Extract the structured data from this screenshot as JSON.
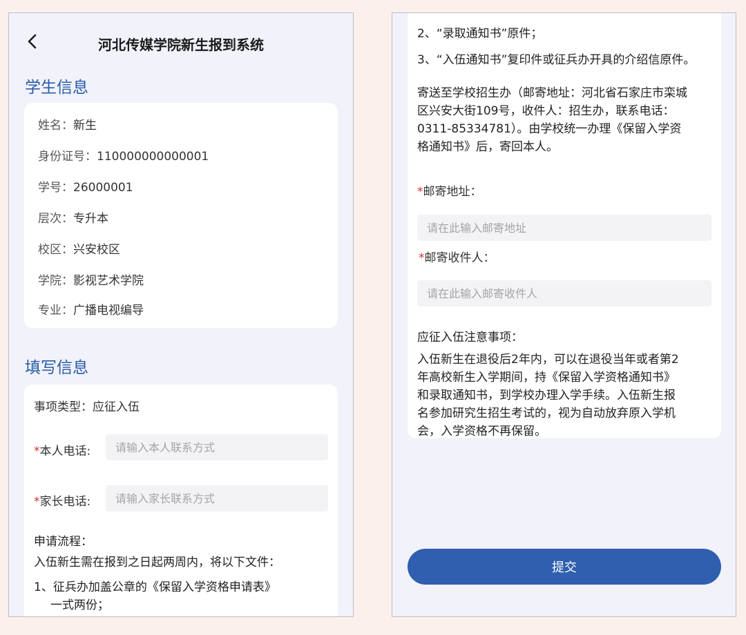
{
  "header": {
    "title": "河北传媒学院新生报到系统"
  },
  "student_info": {
    "section_title": "学生信息",
    "rows": [
      {
        "label": "姓名：",
        "value": "新生"
      },
      {
        "label": "身份证号：",
        "value": "110000000000001"
      },
      {
        "label": "学号：",
        "value": "26000001"
      },
      {
        "label": "层次：",
        "value": "专升本"
      },
      {
        "label": "校区：",
        "value": "兴安校区"
      },
      {
        "label": "学院：",
        "value": "影视艺术学院"
      },
      {
        "label": "专业：",
        "value": "广播电视编导"
      }
    ]
  },
  "fill_info": {
    "section_title": "填写信息",
    "item_type_label": "事项类型：",
    "item_type_value": "应征入伍",
    "phone": {
      "required": "*",
      "label": "本人电话:",
      "placeholder": "请输入本人联系方式",
      "value": ""
    },
    "parent_phone": {
      "required": "*",
      "label": "家长电话:",
      "placeholder": "请输入家长联系方式",
      "value": ""
    },
    "process_title": "申请流程：",
    "process_intro": "入伍新生需在报到之日起两周内，将以下文件：",
    "process_item_1_line1": "1、征兵办加盖公章的《保留入学资格申请表》",
    "process_item_1_line2": "一式两份；",
    "process_item_2": "2、“录取通知书”原件；",
    "process_item_3": "3、“入伍通知书”复印件或征兵办开具的介绍信原件。",
    "mail_lines": [
      "寄送至学校招生办（邮寄地址：河北省石家庄市栾城",
      "区兴安大街109号，收件人：招生办，联系电话：",
      "0311-85334781）。由学校统一办理《保留入学资",
      "格通知书》后，寄回本人。"
    ],
    "mail_address": {
      "required": "*",
      "label": "邮寄地址：",
      "placeholder": "请在此输入邮寄地址",
      "value": ""
    },
    "mail_recipient": {
      "required": "*",
      "label": "邮寄收件人：",
      "placeholder": "请在此输入邮寄收件人",
      "value": ""
    },
    "notes_title": "应征入伍注意事项：",
    "notes_lines": [
      "入伍新生在退役后2年内，可以在退役当年或者第2",
      "年高校新生入学期间，持《保留入学资格通知书》",
      "和录取通知书，到学校办理入学手续。入伍新生报",
      "名参加研究生招生考试的，视为自动放弃原入学机",
      "会，入学资格不再保留。"
    ]
  },
  "submit": {
    "label": "提交"
  },
  "colors": {
    "accent": "#2f5fae",
    "section_title": "#2a5ca8",
    "required": "#d6302b",
    "background": "#f1f2fa"
  }
}
